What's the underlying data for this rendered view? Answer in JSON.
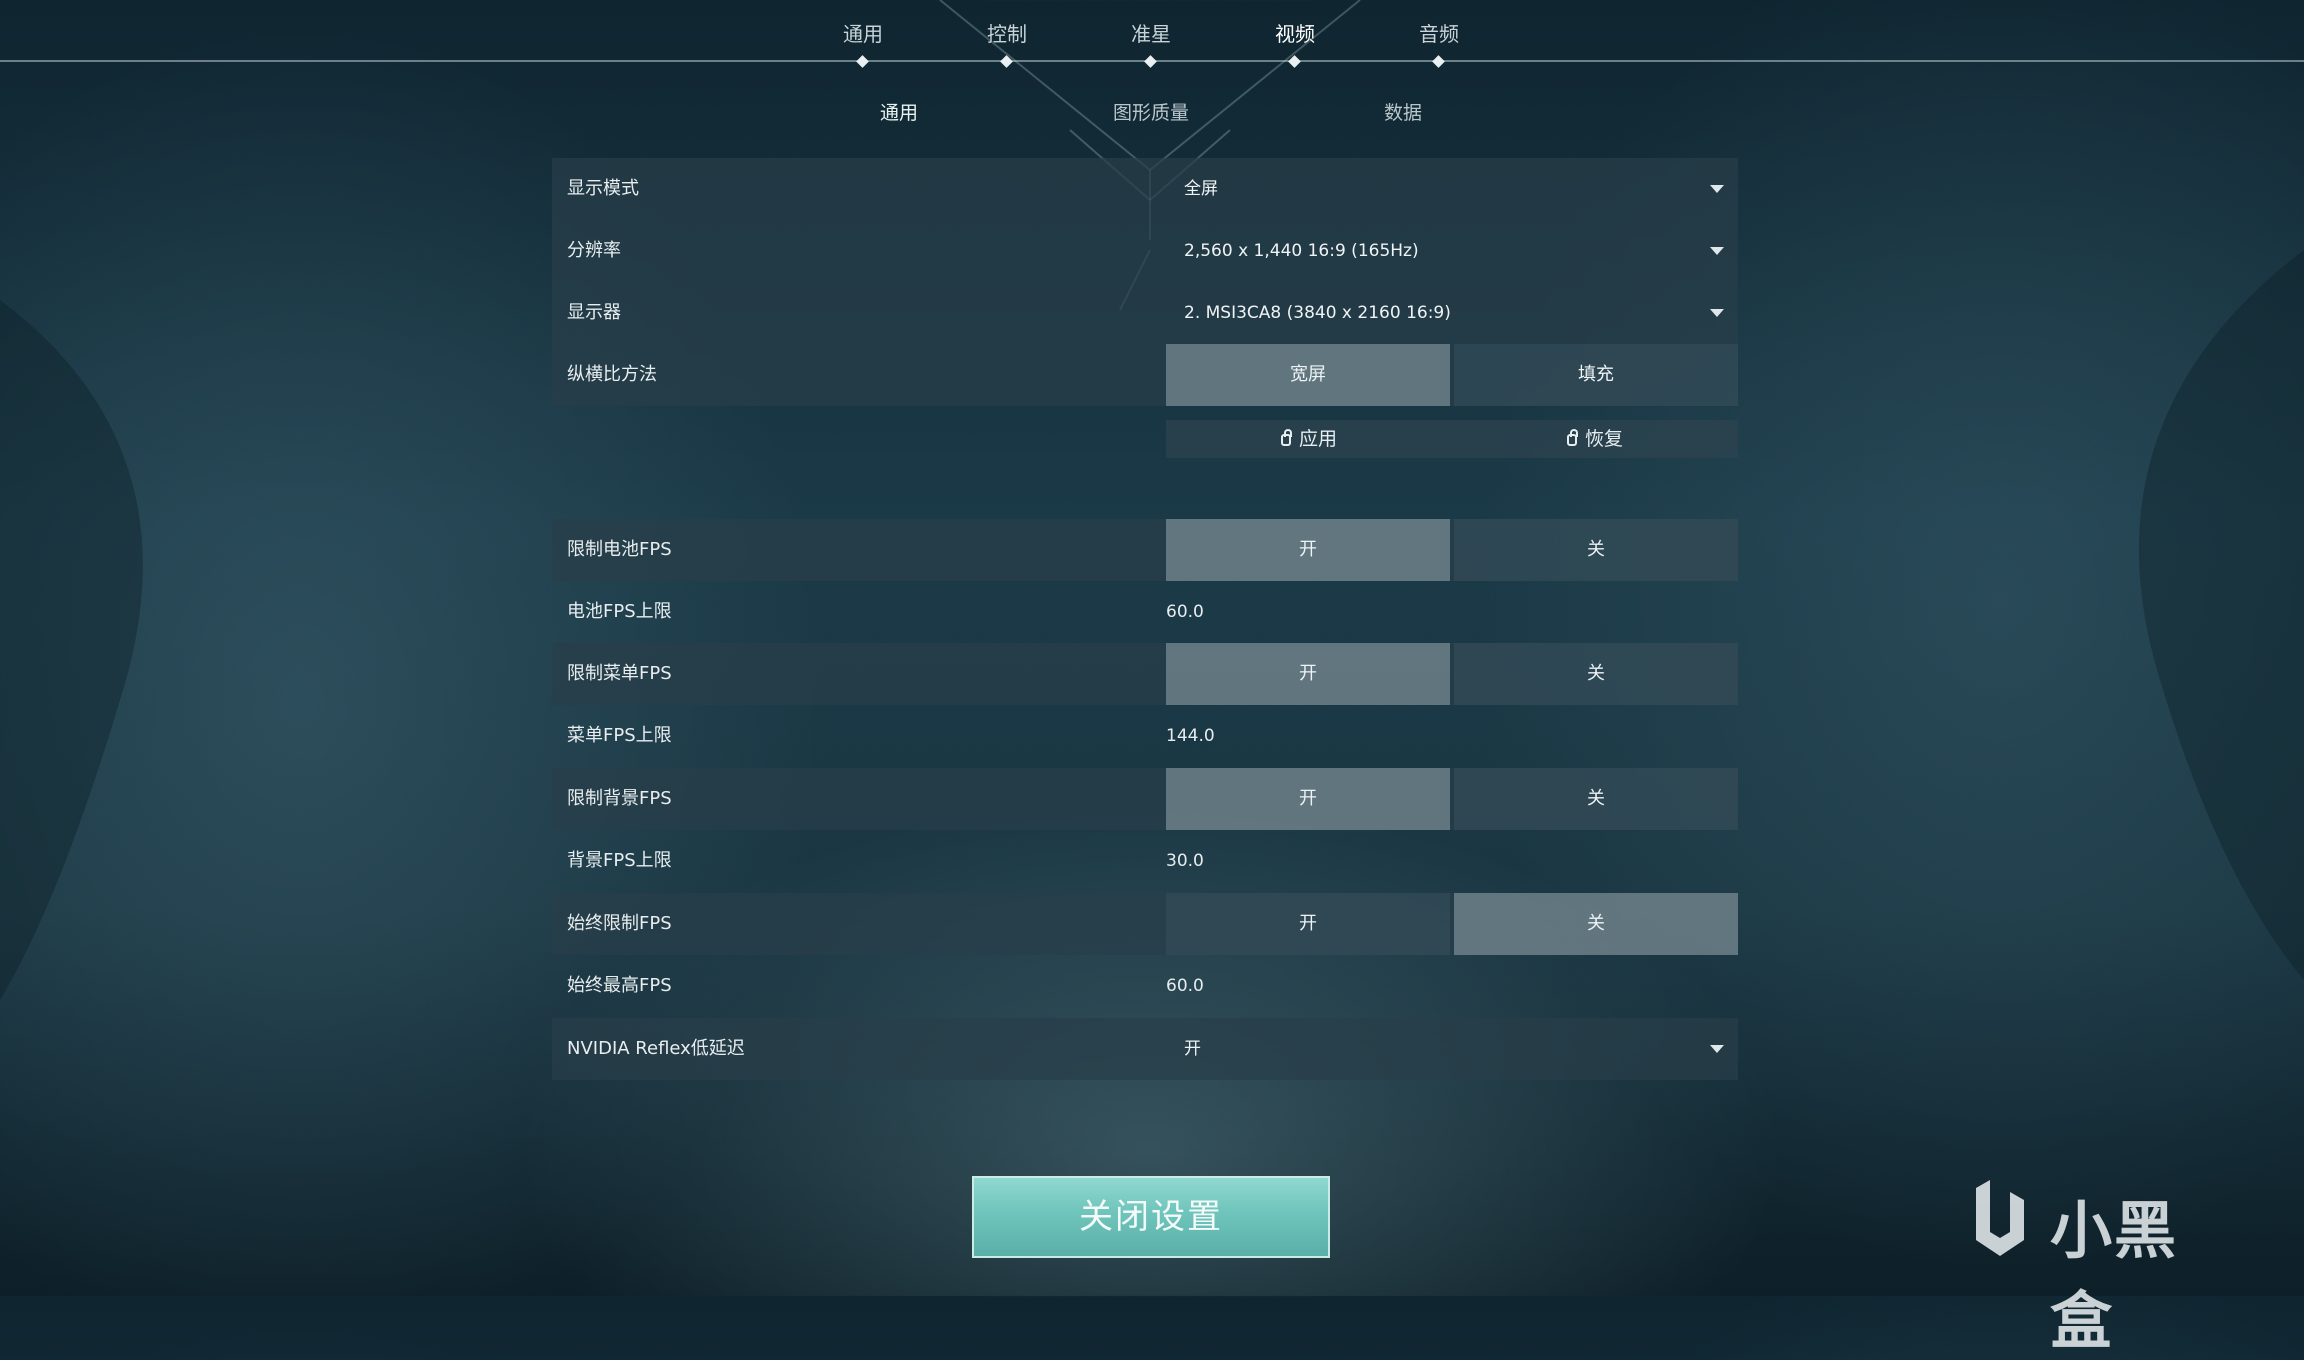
{
  "top_tabs": [
    {
      "label": "通用",
      "active": false
    },
    {
      "label": "控制",
      "active": false
    },
    {
      "label": "准星",
      "active": false
    },
    {
      "label": "视频",
      "active": true
    },
    {
      "label": "音频",
      "active": false
    }
  ],
  "sub_tabs": [
    {
      "label": "通用",
      "active": true
    },
    {
      "label": "图形质量",
      "active": false
    },
    {
      "label": "数据",
      "active": false
    }
  ],
  "settings": {
    "display_mode": {
      "label": "显示模式",
      "value": "全屏"
    },
    "resolution": {
      "label": "分辨率",
      "value": "2,560 x 1,440 16:9 (165Hz)"
    },
    "monitor": {
      "label": "显示器",
      "value": "2. MSI3CA8 (3840 x  2160 16:9)"
    },
    "aspect_method": {
      "label": "纵横比方法",
      "options": [
        "宽屏",
        "填充"
      ],
      "selected": "宽屏"
    },
    "apply_label": "应用",
    "restore_label": "恢复",
    "limit_battery_fps": {
      "label": "限制电池FPS",
      "on_label": "开",
      "off_label": "关",
      "state": "on"
    },
    "battery_fps_max": {
      "label": "电池FPS上限",
      "value": "60.0"
    },
    "limit_menu_fps": {
      "label": "限制菜单FPS",
      "on_label": "开",
      "off_label": "关",
      "state": "on"
    },
    "menu_fps_max": {
      "label": "菜单FPS上限",
      "value": "144.0"
    },
    "limit_background_fps": {
      "label": "限制背景FPS",
      "on_label": "开",
      "off_label": "关",
      "state": "on"
    },
    "background_fps_max": {
      "label": "背景FPS上限",
      "value": "30.0"
    },
    "always_limit_fps": {
      "label": "始终限制FPS",
      "on_label": "开",
      "off_label": "关",
      "state": "off"
    },
    "always_max_fps": {
      "label": "始终最高FPS",
      "value": "60.0"
    },
    "nvidia_reflex": {
      "label": "NVIDIA Reflex低延迟",
      "value": "开"
    }
  },
  "close_button": "关闭设置",
  "watermark_text": "小黑盒"
}
